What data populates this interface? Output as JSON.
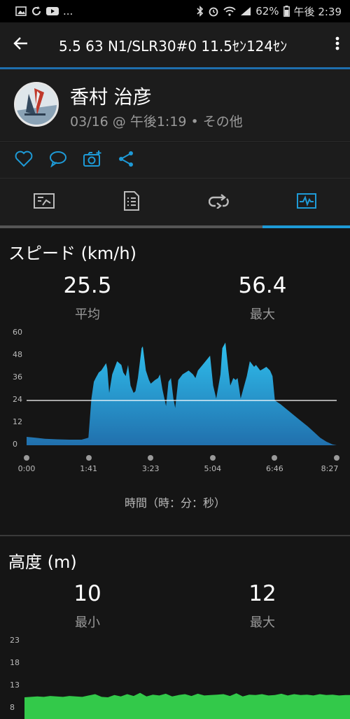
{
  "status_bar": {
    "notification_icons": [
      "gallery-icon",
      "sync-icon",
      "youtube-icon"
    ],
    "more_notifications": "...",
    "battery": "62%",
    "time": "午後 2:39"
  },
  "app_bar": {
    "title": "5.5 63  N1/SLR30#0 11.5ｾﾝ124ｾﾝ"
  },
  "profile": {
    "name": "香村 治彦",
    "meta": "03/16 @ 午後1:19 • その他"
  },
  "actions": [
    "heart-icon",
    "comment-icon",
    "add-photo-icon",
    "share-icon"
  ],
  "tabs": [
    {
      "name": "summary",
      "icon": "map-summary-icon",
      "active": false
    },
    {
      "name": "details",
      "icon": "details-list-icon",
      "active": false
    },
    {
      "name": "laps",
      "icon": "laps-icon",
      "active": false
    },
    {
      "name": "charts",
      "icon": "chart-icon",
      "active": true
    }
  ],
  "speed": {
    "title": "スピード (km/h)",
    "avg_value": "25.5",
    "avg_label": "平均",
    "max_value": "56.4",
    "max_label": "最大",
    "x_axis_title": "時間（時：分：秒）"
  },
  "elevation": {
    "title": "高度 (m)",
    "min_value": "10",
    "min_label": "最小",
    "max_value": "12",
    "max_label": "最大"
  },
  "chart_data": [
    {
      "type": "area",
      "y_ticks": [
        "60",
        "48",
        "36",
        "24",
        "12",
        "0"
      ],
      "ylim": [
        0,
        60
      ],
      "x_ticks": [
        "0:00",
        "1:41",
        "3:23",
        "5:04",
        "6:46",
        "8:27"
      ],
      "xlim": [
        0,
        507
      ],
      "reference_line": 24,
      "color": "#36a9dc",
      "x": [
        0,
        15,
        30,
        50,
        70,
        90,
        101,
        106,
        110,
        113,
        118,
        122,
        126,
        130,
        132,
        135,
        140,
        148,
        155,
        158,
        162,
        166,
        170,
        175,
        178,
        182,
        188,
        190,
        195,
        200,
        203,
        210,
        215,
        218,
        222,
        228,
        232,
        236,
        240,
        243,
        248,
        255,
        265,
        272,
        276,
        280,
        290,
        300,
        305,
        310,
        317,
        320,
        325,
        330,
        333,
        338,
        342,
        345,
        350,
        360,
        365,
        372,
        375,
        382,
        387,
        392,
        398,
        402,
        406,
        415,
        430,
        445,
        460,
        470,
        480,
        490,
        500,
        507
      ],
      "values": [
        4.5,
        4,
        3.5,
        3.2,
        3,
        3,
        4,
        25,
        34,
        36,
        39,
        40,
        42,
        44,
        41,
        28,
        38,
        45,
        43,
        39,
        37,
        43,
        32,
        28,
        29,
        36,
        52,
        53,
        40,
        35,
        33,
        35,
        36,
        38,
        30,
        21,
        34,
        36,
        25,
        20,
        35,
        38,
        40,
        38,
        36,
        40,
        44,
        48,
        32,
        25,
        38,
        52,
        55,
        40,
        32,
        36,
        35,
        36,
        25,
        37,
        45,
        42,
        43,
        40,
        41,
        42,
        40,
        37,
        24,
        22,
        18,
        14,
        10,
        7,
        4,
        2,
        0.5,
        0
      ]
    },
    {
      "type": "area",
      "y_ticks": [
        "23",
        "18",
        "13",
        "8"
      ],
      "ylim": [
        8,
        23
      ],
      "color": "#33c94a",
      "x": [
        0,
        10,
        20,
        30,
        40,
        50,
        60,
        70,
        80,
        90,
        100,
        110,
        120,
        130,
        140,
        150,
        160,
        170,
        180,
        190,
        200,
        210,
        220,
        230,
        240,
        250,
        260,
        270,
        280,
        290,
        300,
        310,
        320,
        330,
        340,
        350,
        360,
        370,
        380,
        390,
        400,
        410,
        420,
        430,
        440,
        450,
        460,
        470,
        480,
        490,
        500,
        507
      ],
      "values": [
        10.5,
        10.6,
        10.7,
        10.6,
        10.8,
        10.7,
        10.6,
        10.8,
        10.7,
        10.6,
        10.9,
        11.2,
        10.6,
        10.5,
        11.0,
        10.7,
        11.2,
        10.8,
        11.5,
        10.7,
        11.1,
        10.9,
        11.3,
        10.7,
        11.0,
        11.2,
        10.8,
        11.3,
        10.9,
        11.0,
        11.1,
        11.2,
        10.8,
        11.4,
        10.7,
        11.1,
        11.0,
        11.2,
        10.9,
        11.0,
        11.3,
        10.9,
        11.2,
        11.0,
        11.1,
        10.9,
        11.2,
        11.0,
        11.1,
        10.9,
        11.0,
        11.0
      ]
    }
  ]
}
